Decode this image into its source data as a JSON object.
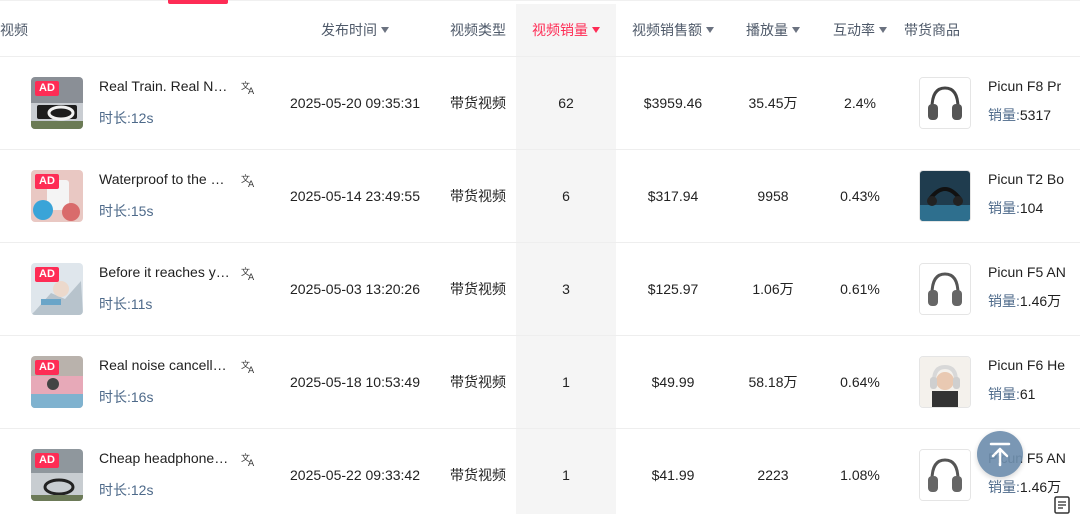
{
  "header": {
    "video": "视频",
    "publish_time": "发布时间",
    "video_type": "视频类型",
    "video_sales": "视频销量",
    "video_revenue": "视频销售额",
    "views": "播放量",
    "engagement": "互动率",
    "products": "带货商品"
  },
  "labels": {
    "duration_prefix": "时长:",
    "sales_prefix": "销量:",
    "ad": "AD"
  },
  "rows": [
    {
      "title": "Real Train. Real Noi…",
      "duration": "时长:12s",
      "publish_time": "2025-05-20 09:35:31",
      "type": "带货视频",
      "sales": "62",
      "revenue": "$3959.46",
      "views": "35.45万",
      "engagement": "2.4%",
      "product_name": "Picun F8 Pr",
      "product_sales_value": "5317"
    },
    {
      "title": "Waterproof to the …",
      "duration": "时长:15s",
      "publish_time": "2025-05-14 23:49:55",
      "type": "带货视频",
      "sales": "6",
      "revenue": "$317.94",
      "views": "9958",
      "engagement": "0.43%",
      "product_name": "Picun T2 Bo",
      "product_sales_value": "104"
    },
    {
      "title": "Before it reaches yo…",
      "duration": "时长:11s",
      "publish_time": "2025-05-03 13:20:26",
      "type": "带货视频",
      "sales": "3",
      "revenue": "$125.97",
      "views": "1.06万",
      "engagement": "0.61%",
      "product_name": "Picun F5 AN",
      "product_sales_value": "1.46万"
    },
    {
      "title": "Real noise cancella…",
      "duration": "时长:16s",
      "publish_time": "2025-05-18 10:53:49",
      "type": "带货视频",
      "sales": "1",
      "revenue": "$49.99",
      "views": "58.18万",
      "engagement": "0.64%",
      "product_name": "Picun F6 He",
      "product_sales_value": "61"
    },
    {
      "title": "Cheap headphones…",
      "duration": "时长:12s",
      "publish_time": "2025-05-22 09:33:42",
      "type": "带货视频",
      "sales": "1",
      "revenue": "$41.99",
      "views": "2223",
      "engagement": "1.08%",
      "product_name": "Picun F5 AN",
      "product_sales_value": "1.46万"
    }
  ],
  "colors": {
    "accent": "#fe2c55",
    "header_text": "#4e5969",
    "label_blue": "#4e6a8a",
    "back_to_top": "#6f8fae"
  },
  "icons": {
    "sort": "caret-down-icon",
    "translate": "translate-icon",
    "back_to_top": "arrow-up-icon",
    "document": "document-icon"
  }
}
